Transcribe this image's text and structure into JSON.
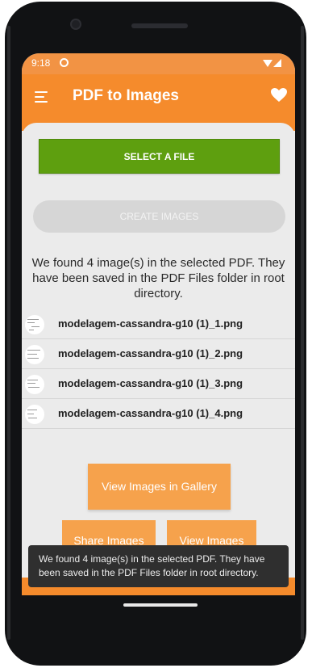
{
  "status_bar": {
    "time": "9:18"
  },
  "app_bar": {
    "title": "PDF to Images",
    "menu_icon": "hamburger-menu-icon",
    "favorite_icon": "heart-icon"
  },
  "actions": {
    "select_file": "SELECT A FILE",
    "create_images": "CREATE IMAGES"
  },
  "message": "We found 4 image(s) in the selected PDF. They have been saved in the PDF Files folder in root directory.",
  "files": [
    {
      "name": "modelagem-cassandra-g10 (1)_1.png"
    },
    {
      "name": "modelagem-cassandra-g10 (1)_2.png"
    },
    {
      "name": "modelagem-cassandra-g10 (1)_3.png"
    },
    {
      "name": "modelagem-cassandra-g10 (1)_4.png"
    }
  ],
  "buttons": {
    "view_gallery": "View Images in Gallery",
    "share_images": "Share Images",
    "view_images": "View Images"
  },
  "toast": "We found 4 image(s) in the selected PDF. They have been saved in the PDF Files folder in root directory.",
  "colors": {
    "primary": "#f58b2c",
    "button_orange": "#f6a24c",
    "select_green": "#5e9f0f",
    "toast_bg": "#2f2f2f"
  }
}
